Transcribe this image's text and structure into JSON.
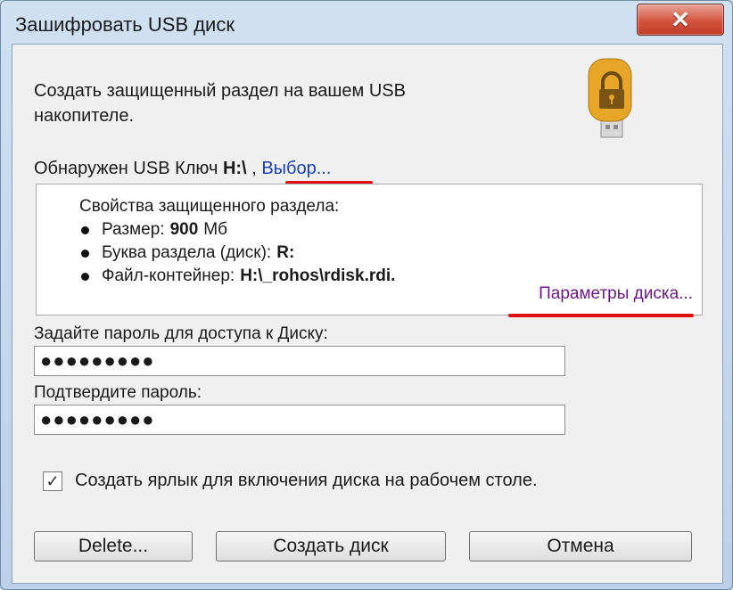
{
  "window": {
    "title": "Зашифровать USB диск",
    "close_label": "✕"
  },
  "intro": {
    "line1": "Создать защищенный раздел на вашем USB",
    "line2": "накопителе."
  },
  "detect": {
    "prefix": "Обнаружен USB Ключ",
    "drive": "H:\\",
    "sep": ",",
    "choose_link": "Выбор..."
  },
  "properties": {
    "title": "Свойства защищенного раздела:",
    "items": [
      {
        "label": "Размер:",
        "value": "900",
        "unit": "Мб"
      },
      {
        "label": "Буква раздела (диск):",
        "value": "R:"
      },
      {
        "label": "Файл-контейнер:",
        "value": "H:\\_rohos\\rdisk.rdi."
      }
    ],
    "params_link": "Параметры диска..."
  },
  "password": {
    "label": "Задайте пароль для доступа к Диску:",
    "value": "●●●●●●●●●"
  },
  "confirm": {
    "label": "Подтвердите пароль:",
    "value": "●●●●●●●●●"
  },
  "shortcut": {
    "checked": true,
    "check_mark": "✓",
    "label": "Создать ярлык для включения диска на рабочем столе."
  },
  "buttons": {
    "delete": "Delete...",
    "create": "Создать диск",
    "cancel": "Отмена"
  },
  "colors": {
    "link": "#1a3fbf",
    "link_visited": "#6b1a8a",
    "highlight_underline": "#e01010",
    "usb_body": "#e8a628"
  },
  "icons": {
    "usb": "usb-drive-lock-icon",
    "close": "close-icon",
    "checkbox": "checkbox-checked-icon"
  }
}
